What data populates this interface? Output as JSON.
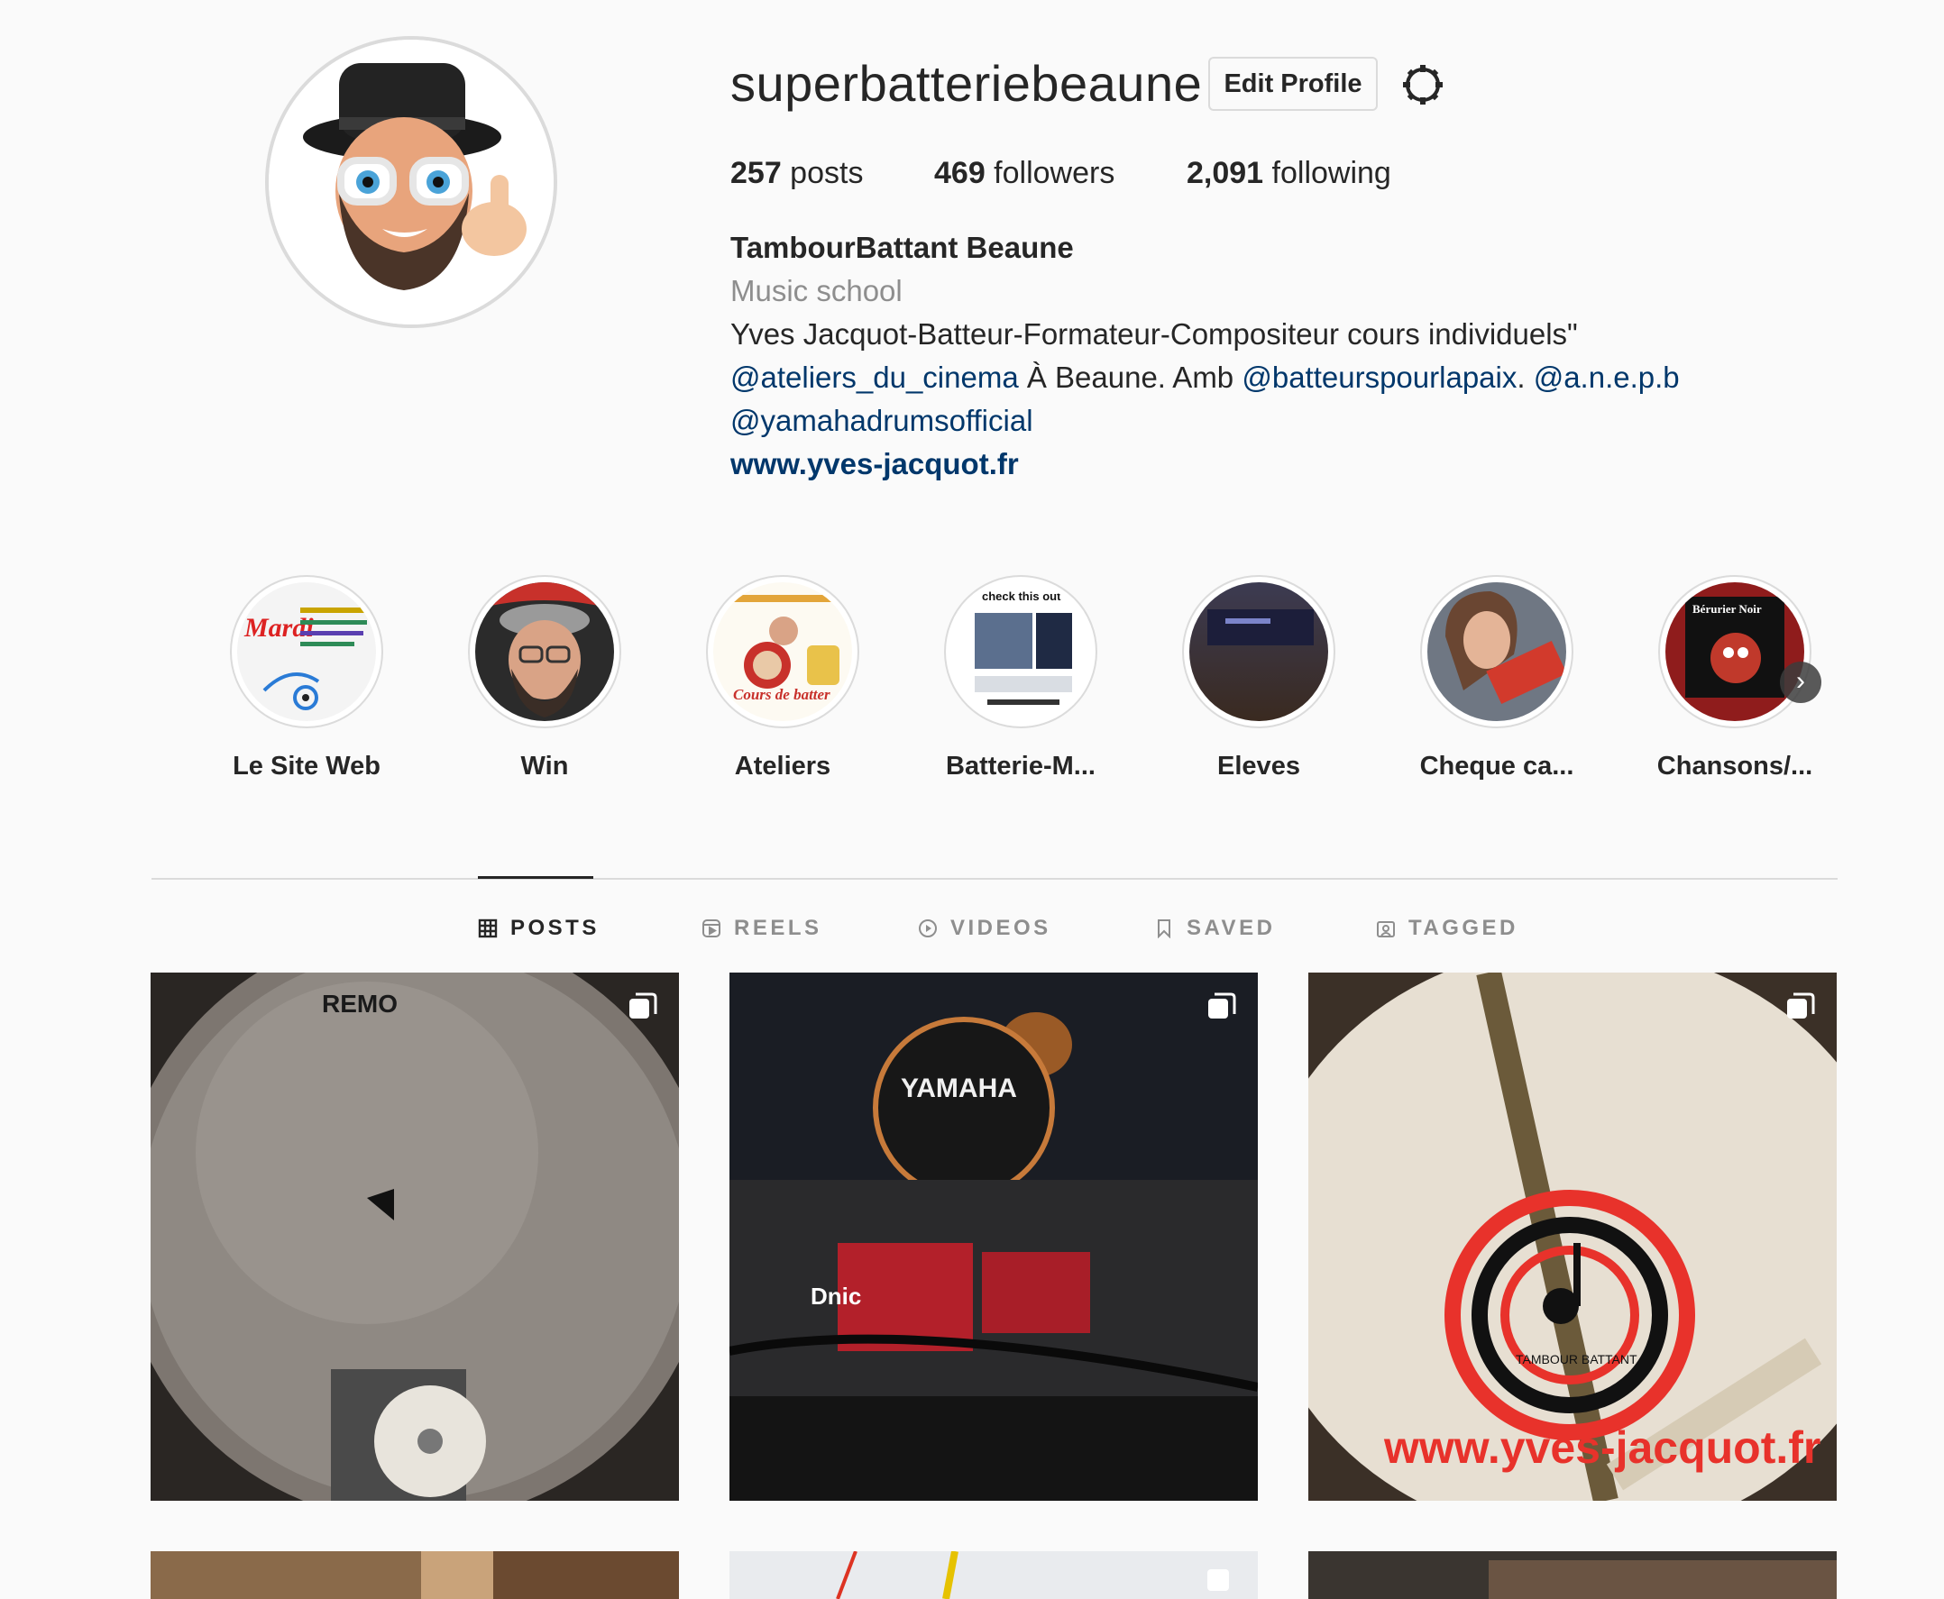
{
  "profile": {
    "username": "superbatteriebeaune",
    "edit_label": "Edit Profile",
    "stats": {
      "posts_count": "257",
      "posts_label": " posts",
      "followers_count": "469",
      "followers_label": " followers",
      "following_count": "2,091",
      "following_label": " following"
    },
    "full_name": "TambourBattant Beaune",
    "category": "Music school",
    "bio": {
      "line1": "Yves Jacquot-Batteur-Formateur-Compositeur cours individuels\"",
      "mention1": "@ateliers_du_cinema",
      "text2": " À Beaune. Amb ",
      "mention2": "@batteurspourlapaix",
      "text3": ". ",
      "mention3": "@a.n.e.p.b",
      "mention4": "@yamahadrumsofficial"
    },
    "website": "www.yves-jacquot.fr"
  },
  "highlights": [
    {
      "label": "Le Site Web"
    },
    {
      "label": "Win"
    },
    {
      "label": "Ateliers"
    },
    {
      "label": "Batterie-M..."
    },
    {
      "label": "Eleves"
    },
    {
      "label": "Cheque ca..."
    },
    {
      "label": "Chansons/..."
    }
  ],
  "highlight_texts": {
    "mardi": "Mardi",
    "cours_de_batter": "Cours de batter",
    "check_this_out": "check this out",
    "beruriers_noir": "Bérurier Noir"
  },
  "tabs": [
    {
      "label": "POSTS",
      "icon": "grid-icon",
      "active": true
    },
    {
      "label": "REELS",
      "icon": "reels-icon",
      "active": false
    },
    {
      "label": "VIDEOS",
      "icon": "play-icon",
      "active": false
    },
    {
      "label": "SAVED",
      "icon": "bookmark-icon",
      "active": false
    },
    {
      "label": "TAGGED",
      "icon": "tagged-icon",
      "active": false
    }
  ],
  "post_texts": {
    "remo": "REMO",
    "yamaha": "YAMAHA",
    "dnic": "Dnic",
    "tambour_battant": "TAMBOUR BATTANT",
    "website_watermark": "www.yves-jacquot.fr"
  },
  "colors": {
    "link": "#00376b",
    "secondary": "#8e8e8e",
    "border": "#dbdbdb",
    "brand_red": "#e8322b"
  }
}
